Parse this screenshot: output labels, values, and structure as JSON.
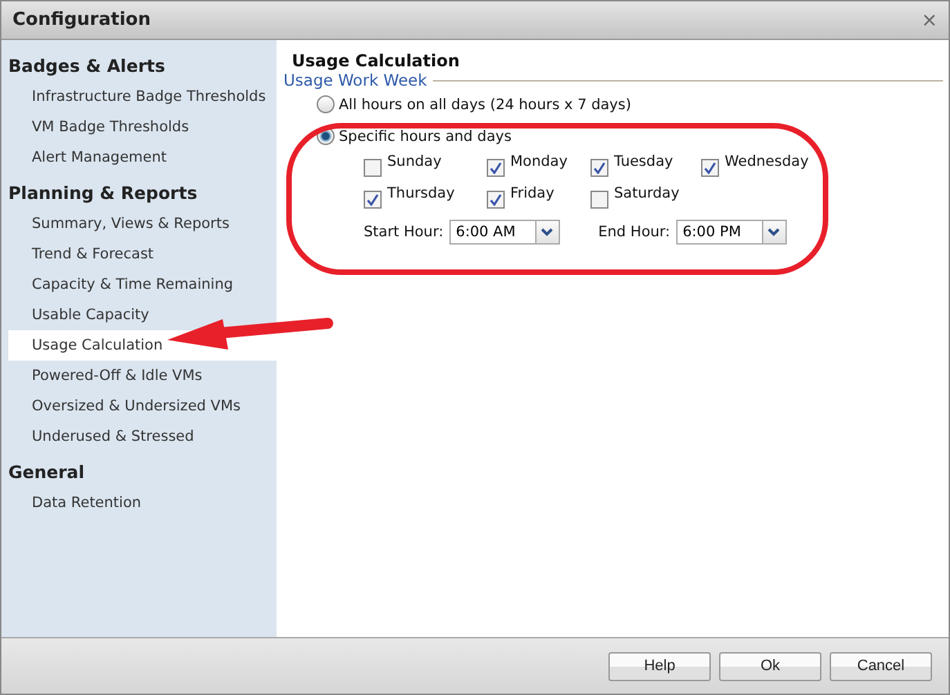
{
  "window": {
    "title": "Configuration",
    "close": "×"
  },
  "sidebar": {
    "groups": [
      {
        "title": "Badges & Alerts",
        "items": [
          {
            "label": "Infrastructure Badge Thresholds",
            "selected": false
          },
          {
            "label": "VM Badge Thresholds",
            "selected": false
          },
          {
            "label": "Alert Management",
            "selected": false
          }
        ]
      },
      {
        "title": "Planning & Reports",
        "items": [
          {
            "label": "Summary, Views & Reports",
            "selected": false
          },
          {
            "label": "Trend & Forecast",
            "selected": false
          },
          {
            "label": "Capacity & Time Remaining",
            "selected": false
          },
          {
            "label": "Usable Capacity",
            "selected": false
          },
          {
            "label": "Usage Calculation",
            "selected": true
          },
          {
            "label": "Powered-Off & Idle VMs",
            "selected": false
          },
          {
            "label": "Oversized & Undersized VMs",
            "selected": false
          },
          {
            "label": "Underused & Stressed",
            "selected": false
          }
        ]
      },
      {
        "title": "General",
        "items": [
          {
            "label": "Data Retention",
            "selected": false
          }
        ]
      }
    ]
  },
  "content": {
    "title": "Usage Calculation",
    "section": "Usage Work Week",
    "options": [
      {
        "label": "All hours on all days (24 hours x 7 days)",
        "selected": false
      },
      {
        "label": "Specific hours and days",
        "selected": true
      }
    ],
    "days": [
      {
        "label": "Sunday",
        "checked": false
      },
      {
        "label": "Monday",
        "checked": true
      },
      {
        "label": "Tuesday",
        "checked": true
      },
      {
        "label": "Wednesday",
        "checked": true
      },
      {
        "label": "Thursday",
        "checked": true
      },
      {
        "label": "Friday",
        "checked": true
      },
      {
        "label": "Saturday",
        "checked": false
      }
    ],
    "start_hour": {
      "label": "Start Hour:",
      "value": "6:00 AM"
    },
    "end_hour": {
      "label": "End Hour:",
      "value": "6:00 PM"
    }
  },
  "buttons": [
    "Help",
    "Ok",
    "Cancel"
  ]
}
